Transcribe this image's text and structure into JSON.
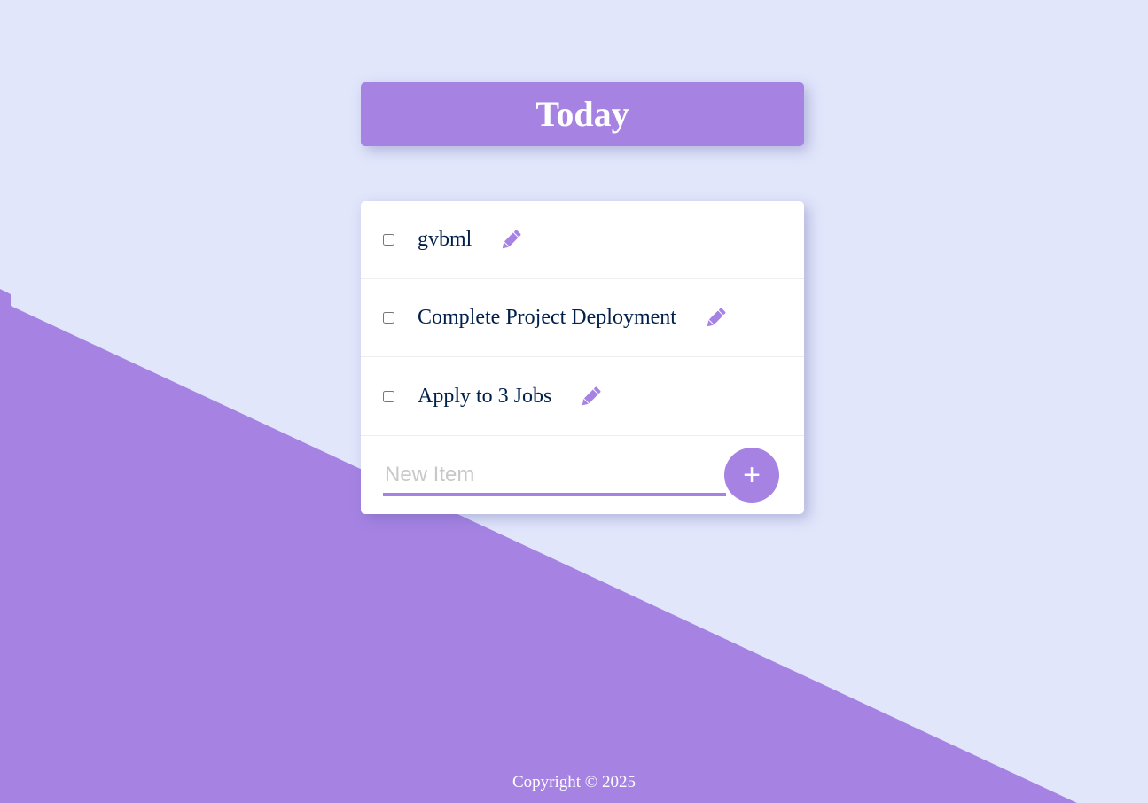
{
  "header": {
    "title": "Today"
  },
  "list": {
    "items": [
      {
        "label": "gvbml",
        "checked": false
      },
      {
        "label": "Complete Project Deployment",
        "checked": false
      },
      {
        "label": "Apply to 3 Jobs",
        "checked": false
      }
    ],
    "new_item": {
      "placeholder": "New Item",
      "value": ""
    },
    "add_button_label": "+"
  },
  "footer": {
    "copyright": "Copyright © 2025"
  },
  "icons": {
    "edit": "pencil-icon",
    "add": "plus-icon"
  },
  "colors": {
    "accent": "#A683E3",
    "background": "#E1E6FB",
    "card": "#FFFFFF",
    "item_text": "#00204A",
    "placeholder": "#C8C8C8"
  }
}
